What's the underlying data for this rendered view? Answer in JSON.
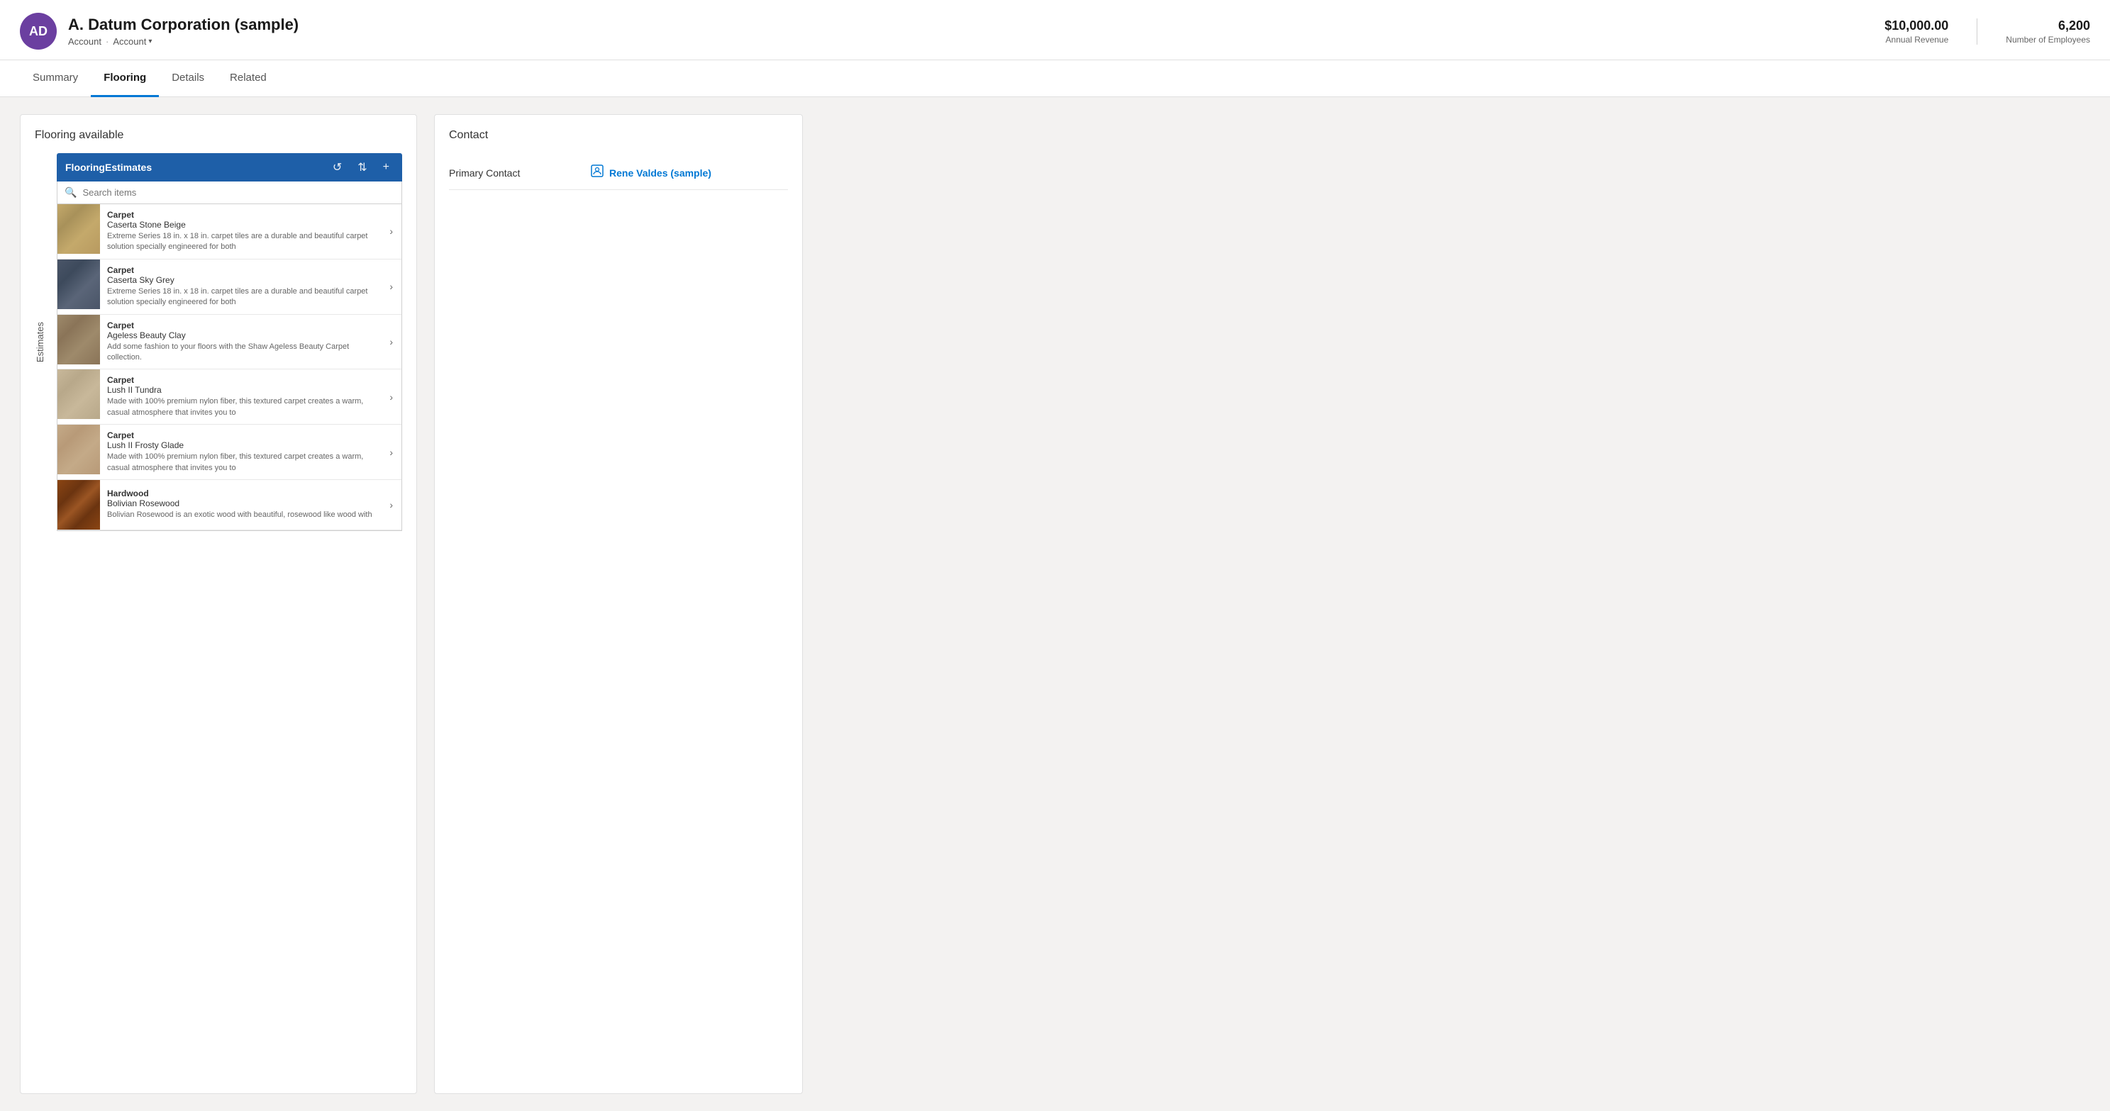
{
  "header": {
    "avatar_initials": "AD",
    "title": "A. Datum Corporation (sample)",
    "breadcrumb1": "Account",
    "breadcrumb2": "Account",
    "annual_revenue_label": "Annual Revenue",
    "annual_revenue_value": "$10,000.00",
    "employees_label": "Number of Employees",
    "employees_value": "6,200"
  },
  "nav": {
    "tabs": [
      {
        "id": "summary",
        "label": "Summary",
        "active": false
      },
      {
        "id": "flooring",
        "label": "Flooring",
        "active": true
      },
      {
        "id": "details",
        "label": "Details",
        "active": false
      },
      {
        "id": "related",
        "label": "Related",
        "active": false
      }
    ]
  },
  "left_panel": {
    "title": "Flooring available",
    "estimates_label": "Estimates",
    "toolbar": {
      "label": "FlooringEstimates",
      "refresh_icon": "↺",
      "sort_icon": "⇅",
      "add_icon": "+"
    },
    "search_placeholder": "Search items",
    "items": [
      {
        "category": "Carpet",
        "name": "Caserta Stone Beige",
        "description": "Extreme Series 18 in. x 18 in. carpet tiles are a durable and beautiful carpet solution specially engineered for both",
        "color_class": "carpet-beige"
      },
      {
        "category": "Carpet",
        "name": "Caserta Sky Grey",
        "description": "Extreme Series 18 in. x 18 in. carpet tiles are a durable and beautiful carpet solution specially engineered for both",
        "color_class": "carpet-grey"
      },
      {
        "category": "Carpet",
        "name": "Ageless Beauty Clay",
        "description": "Add some fashion to your floors with the Shaw Ageless Beauty Carpet collection.",
        "color_class": "carpet-clay"
      },
      {
        "category": "Carpet",
        "name": "Lush II Tundra",
        "description": "Made with 100% premium nylon fiber, this textured carpet creates a warm, casual atmosphere that invites you to",
        "color_class": "carpet-tundra"
      },
      {
        "category": "Carpet",
        "name": "Lush II Frosty Glade",
        "description": "Made with 100% premium nylon fiber, this textured carpet creates a warm, casual atmosphere that invites you to",
        "color_class": "carpet-frosty"
      },
      {
        "category": "Hardwood",
        "name": "Bolivian Rosewood",
        "description": "Bolivian Rosewood is an exotic wood with beautiful, rosewood like wood with",
        "color_class": "hardwood-rosewood"
      }
    ]
  },
  "right_panel": {
    "title": "Contact",
    "primary_contact_label": "Primary Contact",
    "primary_contact_name": "Rene Valdes (sample)"
  }
}
